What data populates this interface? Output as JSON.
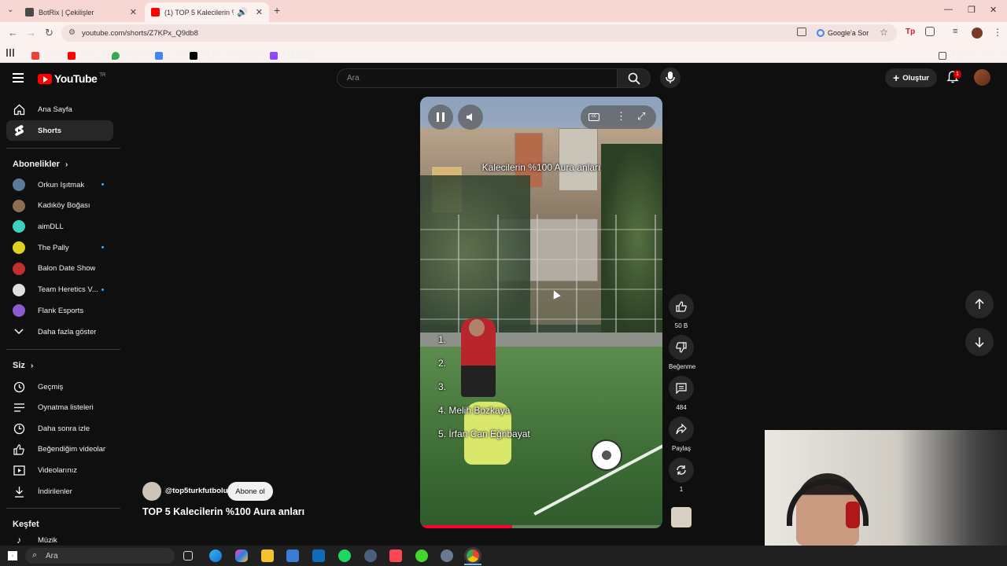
{
  "browser": {
    "tabs": [
      {
        "title": "BotRix | Çekilişler",
        "active": false
      },
      {
        "title": "(1) TOP 5 Kalecilerin %100 A",
        "active": true
      }
    ],
    "url": "youtube.com/shorts/Z7KPx_Q9db8",
    "google_sor": "Google'a Sor",
    "bookmarks": [
      "Gmail",
      "YouTube",
      "Haritalar",
      "Çevir",
      "(10) Anasayfa / Twit...",
      "Twitch"
    ],
    "all_bookmarks": "Tüm Yer İşaretleri"
  },
  "header": {
    "logo": "YouTube",
    "logo_country": "TR",
    "search_placeholder": "Ara",
    "create_label": "Oluştur",
    "notification_count": "1"
  },
  "sidebar": {
    "main": [
      {
        "label": "Ana Sayfa",
        "icon": "home-icon"
      },
      {
        "label": "Shorts",
        "icon": "shorts-icon",
        "active": true
      }
    ],
    "subscriptions_title": "Abonelikler",
    "subscriptions": [
      {
        "label": "Orkun Işıtmak",
        "color": "#5a7a9a",
        "new": true
      },
      {
        "label": "Kadıköy Boğası",
        "color": "#8a7050",
        "new": false
      },
      {
        "label": "aimDLL",
        "color": "#40d0c0",
        "new": false
      },
      {
        "label": "The Pally",
        "color": "#e0d020",
        "new": true
      },
      {
        "label": "Balon Date Show",
        "color": "#c03030",
        "new": false
      },
      {
        "label": "Team Heretics V...",
        "color": "#e0e0e0",
        "new": true
      },
      {
        "label": "Flank Esports",
        "color": "#8a5ad0",
        "new": false
      }
    ],
    "show_more": "Daha fazla göster",
    "you_title": "Siz",
    "you_items": [
      {
        "label": "Geçmiş",
        "icon": "history-icon"
      },
      {
        "label": "Oynatma listeleri",
        "icon": "playlist-icon"
      },
      {
        "label": "Daha sonra izle",
        "icon": "clock-icon"
      },
      {
        "label": "Beğendiğim videolar",
        "icon": "like-icon"
      },
      {
        "label": "Videolarınız",
        "icon": "video-icon"
      },
      {
        "label": "İndirilenler",
        "icon": "download-icon"
      }
    ],
    "explore_title": "Keşfet",
    "explore_items": [
      {
        "label": "Müzik",
        "icon": "music-icon"
      }
    ]
  },
  "video": {
    "overlay_title": "Kalecilerin %100 Aura anları",
    "ranks": [
      "1.",
      "2.",
      "3.",
      "4. Melih Bozkaya",
      "5. İrfan Can Eğribayat"
    ],
    "progress": 0.38
  },
  "actions": {
    "like_count": "50 B",
    "dislike_label": "Beğenme",
    "comment_count": "484",
    "share_label": "Paylaş",
    "remix_count": "1"
  },
  "channel": {
    "handle": "@top5turkfutbolu",
    "subscribe_label": "Abone ol",
    "short_title": "TOP 5 Kalecilerin %100 Aura anları"
  },
  "taskbar": {
    "search_label": "Ara"
  }
}
